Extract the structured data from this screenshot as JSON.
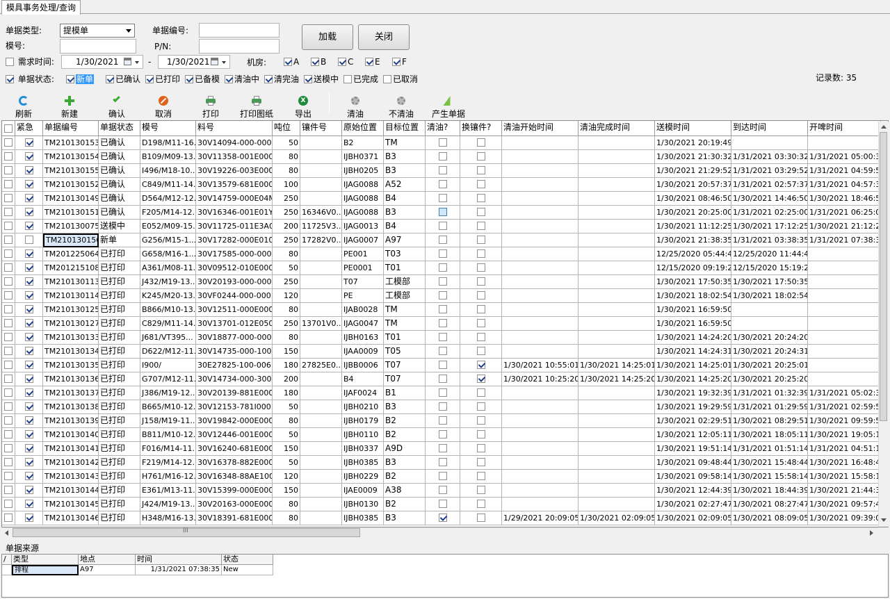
{
  "tab": {
    "title": "模具事务处理/查询"
  },
  "form": {
    "doc_type_label": "单据类型:",
    "doc_type_value": "提模单",
    "doc_no_label": "单据编号:",
    "doc_no_value": "",
    "mold_label": "模号:",
    "mold_value": "",
    "pn_label": "P/N:",
    "pn_value": "",
    "need_time_label": "需求时间:",
    "date_from": "1/30/2021",
    "date_sep": "-",
    "date_to": "1/30/2021",
    "room_label": "机房:",
    "rooms": [
      "A",
      "B",
      "C",
      "E",
      "F"
    ],
    "status_label": "单据状态:",
    "statuses": [
      {
        "label": "新单",
        "checked": true
      },
      {
        "label": "已确认",
        "checked": true
      },
      {
        "label": "已打印",
        "checked": true
      },
      {
        "label": "已备模",
        "checked": true
      },
      {
        "label": "清油中",
        "checked": true
      },
      {
        "label": "清完油",
        "checked": true
      },
      {
        "label": "送模中",
        "checked": true
      },
      {
        "label": "已完成",
        "checked": false
      },
      {
        "label": "已取消",
        "checked": false
      }
    ],
    "load_button": "加载",
    "close_button": "关闭",
    "record_count": "记录数: 35"
  },
  "toolbar": [
    {
      "label": "刷新",
      "icon": "refresh-icon",
      "color": "#1f8fd6"
    },
    {
      "label": "新建",
      "icon": "add-icon",
      "color": "#3aa832"
    },
    {
      "label": "确认",
      "icon": "check-icon",
      "color": "#3aa832"
    },
    {
      "label": "取消",
      "icon": "cancel-icon",
      "color": "#e0621a"
    },
    {
      "label": "打印",
      "icon": "printer-icon",
      "color": "#4a9a55"
    },
    {
      "label": "打印图纸",
      "icon": "printer-icon",
      "color": "#4a9a55"
    },
    {
      "label": "导出",
      "icon": "excel-icon",
      "color": "#1e8a3a"
    },
    {
      "label": "清油",
      "icon": "gear-icon",
      "color": "#8a8a8a"
    },
    {
      "label": "不清油",
      "icon": "gear-icon",
      "color": "#8a8a8a"
    },
    {
      "label": "产生单据",
      "icon": "lightning-icon",
      "color": "#7ac142"
    }
  ],
  "grid": {
    "headers": [
      "紧急",
      "单据编号",
      "单据状态",
      "模号",
      "料号",
      "吨位",
      "镶件号",
      "原始位置",
      "目标位置",
      "清油?",
      "换镶件?",
      "清油开始时间",
      "清油完成时间",
      "送模时间",
      "到达时间",
      "开啤时间"
    ],
    "rows": [
      {
        "urgent": true,
        "no": "TM210130153",
        "status": "已确认",
        "mold": "D198/M11-16...",
        "pn": "30V14094-000-000",
        "ton": "50",
        "insert": "",
        "from": "B2",
        "to": "TM",
        "oil": false,
        "swap": false,
        "oil_start": "",
        "oil_end": "",
        "send": "1/30/2021 20:19:49",
        "arrive": "",
        "open": ""
      },
      {
        "urgent": true,
        "no": "TM210130154",
        "status": "已确认",
        "mold": "B109/M09-13...",
        "pn": "30V11358-001E000",
        "ton": "80",
        "insert": "",
        "from": "IJBH0371",
        "to": "B3",
        "oil": false,
        "swap": false,
        "oil_start": "",
        "oil_end": "",
        "send": "1/30/2021 21:30:32",
        "arrive": "1/31/2021 03:30:32",
        "open": "1/31/2021 05:00:3"
      },
      {
        "urgent": true,
        "no": "TM210130155",
        "status": "已确认",
        "mold": "I496/M18-10...",
        "pn": "30V19226-003E000",
        "ton": "80",
        "insert": "",
        "from": "IJBH0205",
        "to": "B3",
        "oil": false,
        "swap": false,
        "oil_start": "",
        "oil_end": "",
        "send": "1/30/2021 21:29:52",
        "arrive": "1/31/2021 03:29:52",
        "open": "1/31/2021 04:59:5"
      },
      {
        "urgent": true,
        "no": "TM210130152",
        "status": "已确认",
        "mold": "C849/M11-14...",
        "pn": "30V13579-681E000",
        "ton": "100",
        "insert": "",
        "from": "IJAG0088",
        "to": "A52",
        "oil": false,
        "swap": false,
        "oil_start": "",
        "oil_end": "",
        "send": "1/30/2021 20:57:37",
        "arrive": "1/31/2021 02:57:37",
        "open": "1/31/2021 04:57:3"
      },
      {
        "urgent": true,
        "no": "TM210130149",
        "status": "已确认",
        "mold": "D564/M12-12...",
        "pn": "30V14759-000E04M",
        "ton": "250",
        "insert": "",
        "from": "IJAG0088",
        "to": "B4",
        "oil": false,
        "swap": false,
        "oil_start": "",
        "oil_end": "",
        "send": "1/30/2021 08:46:50",
        "arrive": "1/30/2021 14:46:50",
        "open": "1/30/2021 18:46:5"
      },
      {
        "urgent": true,
        "no": "TM210130151",
        "status": "已确认",
        "mold": "F205/M14-12...",
        "pn": "30V16346-001E01Y",
        "ton": "250",
        "insert": "16346V0...",
        "from": "IJAG0088",
        "to": "B3",
        "oil": "blue",
        "swap": false,
        "oil_start": "",
        "oil_end": "",
        "send": "1/30/2021 20:25:00",
        "arrive": "1/31/2021 02:25:00",
        "open": "1/31/2021 06:25:0"
      },
      {
        "urgent": true,
        "no": "TM210130075",
        "status": "送模中",
        "mold": "E052/M09-15...",
        "pn": "30V11725-011E3A0",
        "ton": "200",
        "insert": "11725V3...",
        "from": "IJAG0013",
        "to": "B4",
        "oil": false,
        "swap": false,
        "oil_start": "",
        "oil_end": "",
        "send": "1/30/2021 11:12:25",
        "arrive": "1/30/2021 17:12:25",
        "open": "1/30/2021 21:12:2"
      },
      {
        "urgent": false,
        "no": "TM210130156",
        "status": "新单",
        "mold": "G256/M15-1...",
        "pn": "30V17282-000E010",
        "ton": "250",
        "insert": "17282V0...",
        "from": "IJAG0007",
        "to": "A97",
        "oil": false,
        "swap": false,
        "oil_start": "",
        "oil_end": "",
        "send": "1/30/2021 21:38:35",
        "arrive": "1/31/2021 03:38:35",
        "open": "1/31/2021 07:38:3",
        "selected": true
      },
      {
        "urgent": true,
        "no": "TM201225064",
        "status": "已打印",
        "mold": "G658/M16-1...",
        "pn": "30V17585-000-000",
        "ton": "80",
        "insert": "",
        "from": "PE001",
        "to": "T03",
        "oil": false,
        "swap": false,
        "oil_start": "",
        "oil_end": "",
        "send": "12/25/2020 05:44:44",
        "arrive": "12/25/2020 11:44:44",
        "open": ""
      },
      {
        "urgent": true,
        "no": "TM201215108",
        "status": "已打印",
        "mold": "A361/M08-11...",
        "pn": "30V09512-010E000",
        "ton": "50",
        "insert": "",
        "from": "PE0001",
        "to": "T01",
        "oil": false,
        "swap": false,
        "oil_start": "",
        "oil_end": "",
        "send": "12/15/2020 09:19:25",
        "arrive": "12/15/2020 15:19:25",
        "open": ""
      },
      {
        "urgent": true,
        "no": "TM210130113",
        "status": "已打印",
        "mold": "J432/M19-13...",
        "pn": "30V20193-000-000",
        "ton": "250",
        "insert": "",
        "from": "T07",
        "to": "工模部",
        "oil": false,
        "swap": false,
        "oil_start": "",
        "oil_end": "",
        "send": "1/30/2021 17:50:35",
        "arrive": "1/30/2021 17:50:35",
        "open": ""
      },
      {
        "urgent": true,
        "no": "TM210130114",
        "status": "已打印",
        "mold": "K245/M20-13...",
        "pn": "30VF0244-000-000",
        "ton": "120",
        "insert": "",
        "from": "PE",
        "to": "工模部",
        "oil": false,
        "swap": false,
        "oil_start": "",
        "oil_end": "",
        "send": "1/30/2021 18:02:54",
        "arrive": "1/30/2021 18:02:54",
        "open": ""
      },
      {
        "urgent": true,
        "no": "TM210130125",
        "status": "已打印",
        "mold": "B866/M10-13...",
        "pn": "30V12511-000E000",
        "ton": "80",
        "insert": "",
        "from": "IJAB0028",
        "to": "TM",
        "oil": false,
        "swap": false,
        "oil_start": "",
        "oil_end": "",
        "send": "1/30/2021 16:59:50",
        "arrive": "",
        "open": ""
      },
      {
        "urgent": true,
        "no": "TM210130127",
        "status": "已打印",
        "mold": "C829/M11-14...",
        "pn": "30V13701-012E050",
        "ton": "250",
        "insert": "13701V0...",
        "from": "IJAG0047",
        "to": "TM",
        "oil": false,
        "swap": false,
        "oil_start": "",
        "oil_end": "",
        "send": "1/30/2021 16:59:50",
        "arrive": "",
        "open": ""
      },
      {
        "urgent": true,
        "no": "TM210130133",
        "status": "已打印",
        "mold": "J681/VT395...",
        "pn": "30V18877-000-000",
        "ton": "80",
        "insert": "",
        "from": "IJBH0163",
        "to": "T01",
        "oil": false,
        "swap": false,
        "oil_start": "",
        "oil_end": "",
        "send": "1/30/2021 14:24:20",
        "arrive": "1/30/2021 20:24:20",
        "open": ""
      },
      {
        "urgent": true,
        "no": "TM210130134",
        "status": "已打印",
        "mold": "D622/M12-11...",
        "pn": "30V14735-000-100",
        "ton": "150",
        "insert": "",
        "from": "IJAA0009",
        "to": "T05",
        "oil": false,
        "swap": false,
        "oil_start": "",
        "oil_end": "",
        "send": "1/30/2021 14:24:31",
        "arrive": "1/30/2021 20:24:31",
        "open": ""
      },
      {
        "urgent": true,
        "no": "TM210130135",
        "status": "已打印",
        "mold": "I900/",
        "pn": "30E27825-100-006",
        "ton": "180",
        "insert": "27825E0...",
        "from": "IJBB0006",
        "to": "T07",
        "oil": false,
        "swap": true,
        "oil_start": "1/30/2021 10:55:01",
        "oil_end": "1/30/2021 14:25:01",
        "send": "1/30/2021 14:25:01",
        "arrive": "1/30/2021 20:25:01",
        "open": ""
      },
      {
        "urgent": true,
        "no": "TM210130136",
        "status": "已打印",
        "mold": "G707/M12-11...",
        "pn": "30V14734-000-300",
        "ton": "200",
        "insert": "",
        "from": "B4",
        "to": "T07",
        "oil": false,
        "swap": true,
        "oil_start": "1/30/2021 10:25:20",
        "oil_end": "1/30/2021 14:25:20",
        "send": "1/30/2021 14:25:20",
        "arrive": "1/30/2021 20:25:20",
        "open": ""
      },
      {
        "urgent": true,
        "no": "TM210130137",
        "status": "已打印",
        "mold": "J386/M19-12...",
        "pn": "30V20139-881E000",
        "ton": "180",
        "insert": "",
        "from": "IJAF0024",
        "to": "B1",
        "oil": false,
        "swap": false,
        "oil_start": "",
        "oil_end": "",
        "send": "1/30/2021 19:32:39",
        "arrive": "1/31/2021 01:32:39",
        "open": "1/31/2021 05:02:3"
      },
      {
        "urgent": true,
        "no": "TM210130138",
        "status": "已打印",
        "mold": "B665/M10-12...",
        "pn": "30V12153-781I000",
        "ton": "50",
        "insert": "",
        "from": "IJBH0210",
        "to": "B3",
        "oil": false,
        "swap": false,
        "oil_start": "",
        "oil_end": "",
        "send": "1/30/2021 19:29:59",
        "arrive": "1/31/2021 01:29:59",
        "open": "1/31/2021 02:59:5"
      },
      {
        "urgent": true,
        "no": "TM210130139",
        "status": "已打印",
        "mold": "J158/M19-11...",
        "pn": "30V19842-000E000",
        "ton": "80",
        "insert": "",
        "from": "IJBH0179",
        "to": "B2",
        "oil": false,
        "swap": false,
        "oil_start": "",
        "oil_end": "",
        "send": "1/30/2021 02:29:51",
        "arrive": "1/30/2021 08:29:51",
        "open": "1/30/2021 09:59:5"
      },
      {
        "urgent": true,
        "no": "TM210130140",
        "status": "已打印",
        "mold": "B811/M10-12...",
        "pn": "30V12446-001E000",
        "ton": "50",
        "insert": "",
        "from": "IJBH0110",
        "to": "B2",
        "oil": false,
        "swap": false,
        "oil_start": "",
        "oil_end": "",
        "send": "1/30/2021 12:05:11",
        "arrive": "1/30/2021 18:05:11",
        "open": "1/30/2021 19:05:1"
      },
      {
        "urgent": true,
        "no": "TM210130141",
        "status": "已打印",
        "mold": "F016/M14-11...",
        "pn": "30V16240-681E000",
        "ton": "150",
        "insert": "",
        "from": "IJBH0337",
        "to": "A9D",
        "oil": false,
        "swap": false,
        "oil_start": "",
        "oil_end": "",
        "send": "1/30/2021 19:51:14",
        "arrive": "1/31/2021 01:51:14",
        "open": "1/31/2021 04:51:1"
      },
      {
        "urgent": true,
        "no": "TM210130142",
        "status": "已打印",
        "mold": "F219/M14-12...",
        "pn": "30V16378-882E000",
        "ton": "50",
        "insert": "",
        "from": "IJBH0385",
        "to": "B3",
        "oil": false,
        "swap": false,
        "oil_start": "",
        "oil_end": "",
        "send": "1/30/2021 09:48:44",
        "arrive": "1/30/2021 15:48:44",
        "open": "1/30/2021 16:48:4"
      },
      {
        "urgent": true,
        "no": "TM210130143",
        "status": "已打印",
        "mold": "H761/M16-12...",
        "pn": "30V16348-88AE100",
        "ton": "120",
        "insert": "",
        "from": "IJBH0229",
        "to": "B2",
        "oil": false,
        "swap": false,
        "oil_start": "",
        "oil_end": "",
        "send": "1/30/2021 09:58:14",
        "arrive": "1/30/2021 15:58:14",
        "open": "1/30/2021 15:58:1"
      },
      {
        "urgent": true,
        "no": "TM210130144",
        "status": "已打印",
        "mold": "E361/M13-11...",
        "pn": "30V15399-000E000",
        "ton": "150",
        "insert": "",
        "from": "IJAE0009",
        "to": "A38",
        "oil": false,
        "swap": false,
        "oil_start": "",
        "oil_end": "",
        "send": "1/30/2021 12:44:39",
        "arrive": "1/30/2021 18:44:39",
        "open": "1/30/2021 21:44:3"
      },
      {
        "urgent": true,
        "no": "TM210130145",
        "status": "已打印",
        "mold": "J424/M19-13...",
        "pn": "30V20163-000E000",
        "ton": "80",
        "insert": "",
        "from": "IJBH0130",
        "to": "B2",
        "oil": false,
        "swap": false,
        "oil_start": "",
        "oil_end": "",
        "send": "1/30/2021 02:27:47",
        "arrive": "1/30/2021 08:27:47",
        "open": "1/30/2021 09:57:4"
      },
      {
        "urgent": true,
        "no": "TM210130146",
        "status": "已打印",
        "mold": "H348/M16-13...",
        "pn": "30V18391-681E000",
        "ton": "80",
        "insert": "",
        "from": "IJBH0385",
        "to": "B3",
        "oil": true,
        "swap": false,
        "oil_start": "1/29/2021 20:09:05",
        "oil_end": "1/30/2021 02:09:05",
        "send": "1/30/2021 02:09:05",
        "arrive": "1/30/2021 08:09:05",
        "open": "1/30/2021 09:39:0"
      }
    ]
  },
  "hscroll_mark": "III",
  "source": {
    "title": "单据来源",
    "headers": [
      "类型",
      "地点",
      "时间",
      "状态"
    ],
    "rows": [
      {
        "type": "排程",
        "place": "A97",
        "time": "1/31/2021 07:38:35",
        "state": "New"
      }
    ]
  }
}
